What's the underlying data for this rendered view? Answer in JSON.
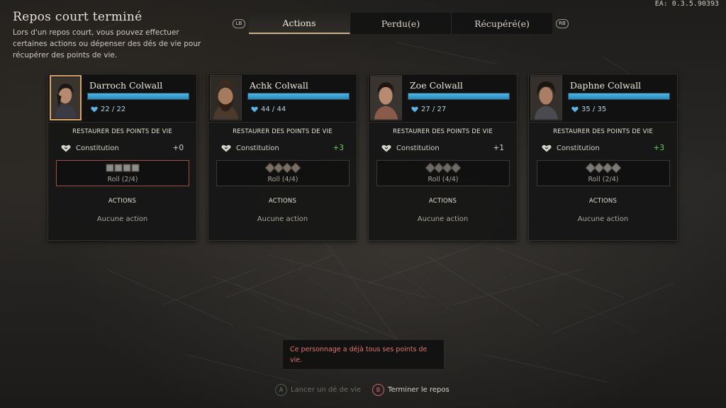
{
  "version": "EA: 0.3.5.90393",
  "header": {
    "title": "Repos court terminé",
    "description": "Lors d'un repos court, vous pouvez effectuer certaines actions ou dépenser des dés de vie pour récupérer des points de vie."
  },
  "tabs": {
    "left_shoulder": "LB",
    "right_shoulder": "RB",
    "items": [
      {
        "label": "Actions",
        "active": true
      },
      {
        "label": "Perdu(e)",
        "active": false
      },
      {
        "label": "Récupéré(e)",
        "active": false
      }
    ]
  },
  "cards": [
    {
      "name": "Darroch Colwall",
      "hp": "22 / 22",
      "hp_fraction": 1.0,
      "selected": true,
      "restore_title": "RESTAURER DES POINTS DE VIE",
      "stat_label": "Constitution",
      "stat_value": "+0",
      "stat_positive": false,
      "roll": "Roll (2/4)",
      "actions_title": "ACTIONS",
      "actions_empty": "Aucune action"
    },
    {
      "name": "Achk Colwall",
      "hp": "44 / 44",
      "hp_fraction": 1.0,
      "selected": false,
      "restore_title": "RESTAURER DES POINTS DE VIE",
      "stat_label": "Constitution",
      "stat_value": "+3",
      "stat_positive": true,
      "roll": "Roll (4/4)",
      "actions_title": "ACTIONS",
      "actions_empty": "Aucune action"
    },
    {
      "name": "Zoe Colwall",
      "hp": "27 / 27",
      "hp_fraction": 1.0,
      "selected": false,
      "restore_title": "RESTAURER DES POINTS DE VIE",
      "stat_label": "Constitution",
      "stat_value": "+1",
      "stat_positive": false,
      "roll": "Roll (4/4)",
      "actions_title": "ACTIONS",
      "actions_empty": "Aucune action"
    },
    {
      "name": "Daphne Colwall",
      "hp": "35 / 35",
      "hp_fraction": 1.0,
      "selected": false,
      "restore_title": "RESTAURER DES POINTS DE VIE",
      "stat_label": "Constitution",
      "stat_value": "+3",
      "stat_positive": true,
      "roll": "Roll (2/4)",
      "actions_title": "ACTIONS",
      "actions_empty": "Aucune action"
    }
  ],
  "tooltip": "Ce personnage a déjà tous ses points de vie.",
  "footer": {
    "roll_glyph": "A",
    "roll_label": "Lancer un dé de vie",
    "end_glyph": "B",
    "end_label": "Terminer le repos"
  },
  "colors": {
    "hp_bar": "#3a9fd2",
    "positive_stat": "#5fd35a",
    "selected_portrait": "#d8a46a",
    "tooltip_text": "#e0776a"
  }
}
